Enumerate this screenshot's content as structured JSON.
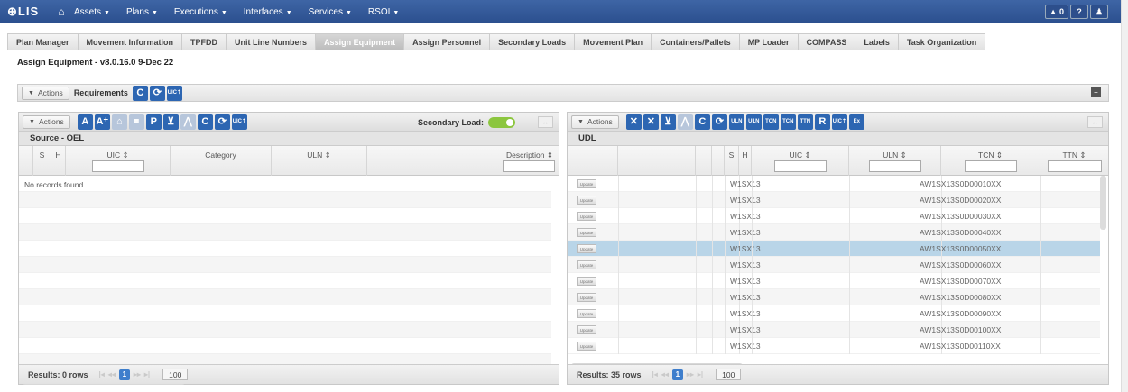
{
  "nav": {
    "logo": "LIS",
    "items": [
      {
        "label": "Assets"
      },
      {
        "label": "Plans"
      },
      {
        "label": "Executions"
      },
      {
        "label": "Interfaces"
      },
      {
        "label": "Services"
      },
      {
        "label": "RSOI"
      }
    ],
    "right_buttons": [
      "▲ 0",
      "?",
      "♟"
    ]
  },
  "tabs": [
    "Plan Manager",
    "Movement Information",
    "TPFDD",
    "Unit Line Numbers",
    "Assign Equipment",
    "Assign Personnel",
    "Secondary Loads",
    "Movement Plan",
    "Containers/Pallets",
    "MP Loader",
    "COMPASS",
    "Labels",
    "Task Organization"
  ],
  "active_tab": "Assign Equipment",
  "app_title": "Assign Equipment - v8.0.16.0 9-Dec 22",
  "requirements_bar": {
    "actions_label": "Actions",
    "title": "Requirements"
  },
  "left_panel": {
    "actions_label": "Actions",
    "secondary_load_label": "Secondary Load:",
    "toggle_text": "on",
    "title": "Source - OEL",
    "columns": {
      "s": "S",
      "h": "H",
      "uic": "UIC ⇕",
      "category": "Category",
      "uln": "ULN ⇕",
      "description": "Description ⇕"
    },
    "empty_message": "No records found.",
    "footer": {
      "results": "Results: 0 rows",
      "page": "1",
      "page_size": "100"
    }
  },
  "right_panel": {
    "actions_label": "Actions",
    "title": "UDL",
    "columns": {
      "s": "S",
      "h": "H",
      "uic": "UIC ⇕",
      "uln": "ULN ⇕",
      "tcn": "TCN ⇕",
      "ttn": "TTN ⇕"
    },
    "update_label": "Update",
    "rows": [
      {
        "uic": "W1SX13",
        "tcn": "AW1SX13S0D00010XX"
      },
      {
        "uic": "W1SX13",
        "tcn": "AW1SX13S0D00020XX"
      },
      {
        "uic": "W1SX13",
        "tcn": "AW1SX13S0D00030XX"
      },
      {
        "uic": "W1SX13",
        "tcn": "AW1SX13S0D00040XX"
      },
      {
        "uic": "W1SX13",
        "tcn": "AW1SX13S0D00050XX"
      },
      {
        "uic": "W1SX13",
        "tcn": "AW1SX13S0D00060XX"
      },
      {
        "uic": "W1SX13",
        "tcn": "AW1SX13S0D00070XX"
      },
      {
        "uic": "W1SX13",
        "tcn": "AW1SX13S0D00080XX"
      },
      {
        "uic": "W1SX13",
        "tcn": "AW1SX13S0D00090XX"
      },
      {
        "uic": "W1SX13",
        "tcn": "AW1SX13S0D00100XX"
      },
      {
        "uic": "W1SX13",
        "tcn": "AW1SX13S0D00110XX"
      }
    ],
    "selected_row": 4,
    "footer": {
      "results": "Results: 35 rows",
      "page": "1",
      "page_size": "100"
    }
  },
  "colors": {
    "nav": "#2b4f8e",
    "toolbar_icon": "#2d66b2",
    "selected_row": "#b9d5e8",
    "toggle": "#8cc63f"
  }
}
